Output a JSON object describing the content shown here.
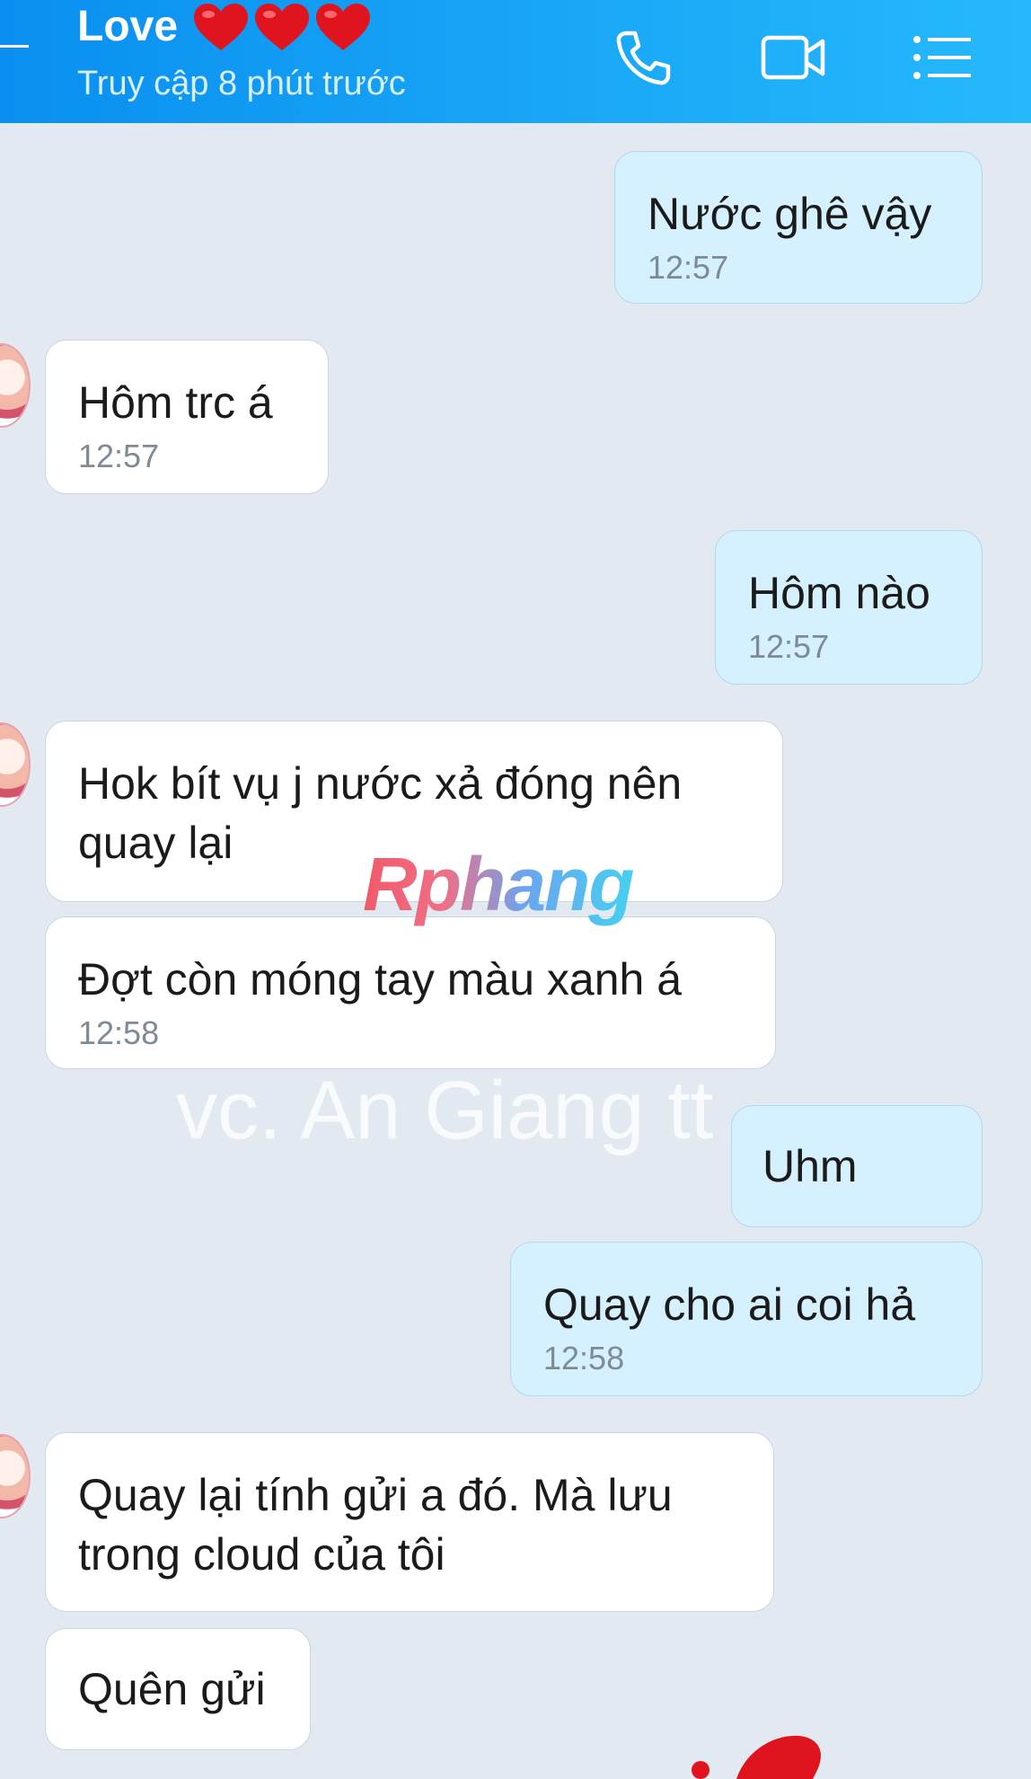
{
  "header": {
    "title": "Love",
    "subtitle": "Truy cập 8 phút trước",
    "icons": [
      "back-icon",
      "heart-icon",
      "phone-icon",
      "video-call-icon",
      "menu-list-icon"
    ],
    "colors": {
      "bar": "#0a8ff0",
      "heart": "#e0141e"
    }
  },
  "messages": [
    {
      "direction": "out",
      "text": "Nước ghê vậy",
      "time": "12:57"
    },
    {
      "direction": "in",
      "text": "Hôm trc á",
      "time": "12:57"
    },
    {
      "direction": "out",
      "text": "Hôm nào",
      "time": "12:57"
    },
    {
      "direction": "in",
      "line1": "Hok bít vụ j nước xả đóng nên",
      "line2": "quay lại"
    },
    {
      "direction": "in",
      "text": "Đợt còn móng tay màu xanh á",
      "time": "12:58"
    },
    {
      "direction": "out",
      "text": "Uhm"
    },
    {
      "direction": "out",
      "text": "Quay cho ai coi hả",
      "time": "12:58"
    },
    {
      "direction": "in",
      "line1": "Quay lại tính gửi a đó. Mà lưu",
      "line2": "trong cloud của tôi"
    },
    {
      "direction": "in",
      "text": "Quên gửi"
    }
  ],
  "watermark": {
    "logo": "Rphang",
    "text": "vc. An Giang tt"
  },
  "theme": {
    "background": "#e2e9f1",
    "outgoing_bubble": "#d5f1ff",
    "incoming_bubble": "#ffffff",
    "time_color": "#7e8a96"
  }
}
